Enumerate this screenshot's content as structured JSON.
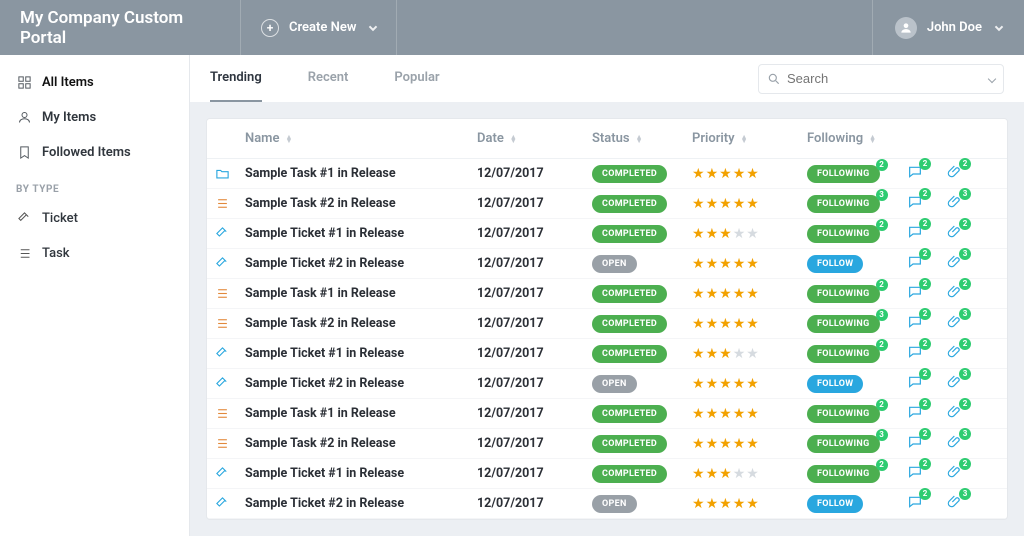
{
  "header": {
    "brand": "My Company Custom Portal",
    "create_label": "Create New",
    "user_name": "John Doe"
  },
  "sidebar": {
    "all": "All Items",
    "my": "My Items",
    "followed": "Followed Items",
    "section": "BY TYPE",
    "ticket": "Ticket",
    "task": "Task"
  },
  "tabs": {
    "trending": "Trending",
    "recent": "Recent",
    "popular": "Popular",
    "search_placeholder": "Search"
  },
  "columns": {
    "name": "Name",
    "date": "Date",
    "status": "Status",
    "priority": "Priority",
    "following": "Following"
  },
  "status": {
    "completed": "COMPLETED",
    "open": "OPEN",
    "following": "FOLLOWING",
    "follow": "FOLLOW"
  },
  "rows": [
    {
      "icon": "folder",
      "name": "Sample Task #1 in Release",
      "date": "12/07/2017",
      "status": "completed",
      "stars": 5,
      "follow": "following",
      "followCount": 2,
      "comments": 2,
      "attach": 2
    },
    {
      "icon": "task",
      "name": "Sample Task #2 in Release",
      "date": "12/07/2017",
      "status": "completed",
      "stars": 5,
      "follow": "following",
      "followCount": 3,
      "comments": 2,
      "attach": 3
    },
    {
      "icon": "ticket",
      "name": "Sample Ticket #1 in Release",
      "date": "12/07/2017",
      "status": "completed",
      "stars": 3,
      "follow": "following",
      "followCount": 2,
      "comments": 2,
      "attach": 2
    },
    {
      "icon": "ticket",
      "name": "Sample Ticket #2 in Release",
      "date": "12/07/2017",
      "status": "open",
      "stars": 5,
      "follow": "follow",
      "followCount": null,
      "comments": 2,
      "attach": 3
    },
    {
      "icon": "task",
      "name": "Sample Task #1 in Release",
      "date": "12/07/2017",
      "status": "completed",
      "stars": 5,
      "follow": "following",
      "followCount": 2,
      "comments": 2,
      "attach": 2
    },
    {
      "icon": "task",
      "name": "Sample Task #2 in Release",
      "date": "12/07/2017",
      "status": "completed",
      "stars": 5,
      "follow": "following",
      "followCount": 3,
      "comments": 2,
      "attach": 3
    },
    {
      "icon": "ticket",
      "name": "Sample Ticket #1 in Release",
      "date": "12/07/2017",
      "status": "completed",
      "stars": 3,
      "follow": "following",
      "followCount": 2,
      "comments": 2,
      "attach": 2
    },
    {
      "icon": "ticket",
      "name": "Sample Ticket #2 in Release",
      "date": "12/07/2017",
      "status": "open",
      "stars": 5,
      "follow": "follow",
      "followCount": null,
      "comments": 2,
      "attach": 3
    },
    {
      "icon": "task",
      "name": "Sample Task #1 in Release",
      "date": "12/07/2017",
      "status": "completed",
      "stars": 5,
      "follow": "following",
      "followCount": 2,
      "comments": 2,
      "attach": 2
    },
    {
      "icon": "task",
      "name": "Sample Task #2 in Release",
      "date": "12/07/2017",
      "status": "completed",
      "stars": 5,
      "follow": "following",
      "followCount": 3,
      "comments": 2,
      "attach": 3
    },
    {
      "icon": "ticket",
      "name": "Sample Ticket #1 in Release",
      "date": "12/07/2017",
      "status": "completed",
      "stars": 3,
      "follow": "following",
      "followCount": 2,
      "comments": 2,
      "attach": 2
    },
    {
      "icon": "ticket",
      "name": "Sample Ticket #2 in Release",
      "date": "12/07/2017",
      "status": "open",
      "stars": 5,
      "follow": "follow",
      "followCount": null,
      "comments": 2,
      "attach": 3
    }
  ]
}
